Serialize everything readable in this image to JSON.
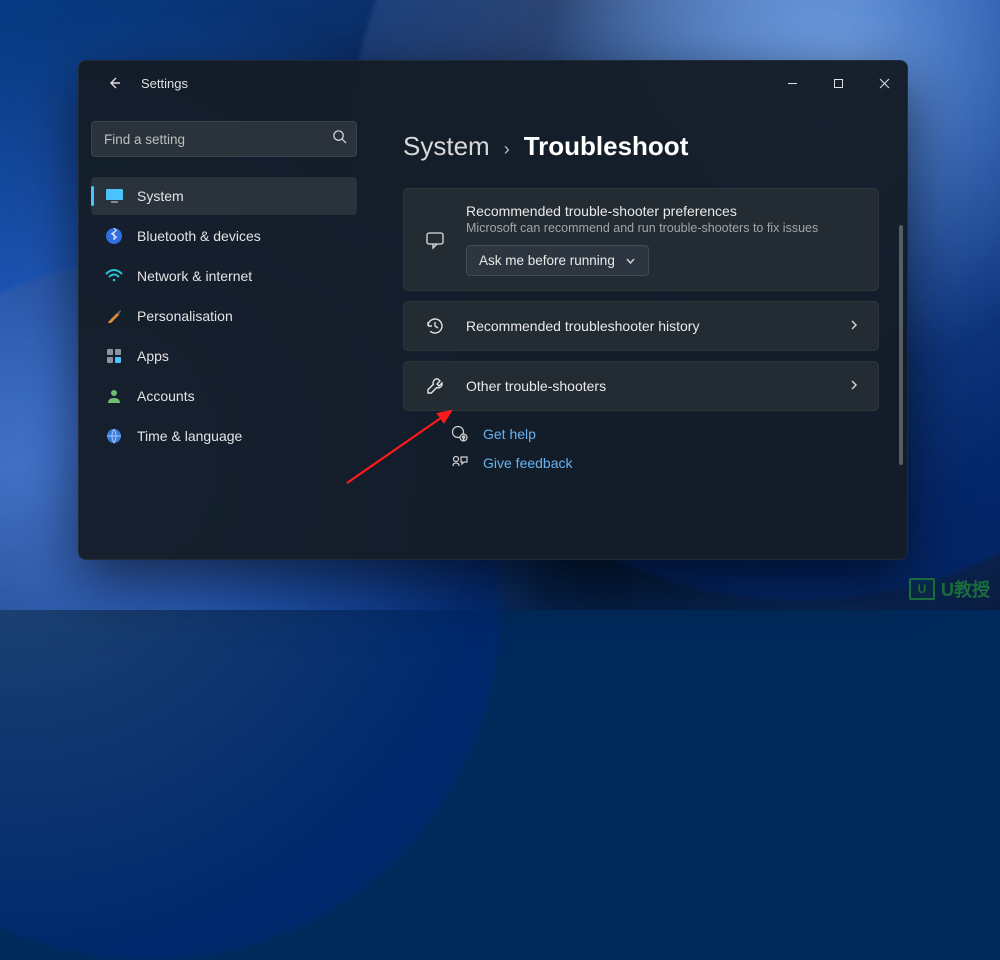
{
  "header": {
    "app_title": "Settings"
  },
  "sidebar": {
    "search_placeholder": "Find a setting",
    "items": [
      {
        "icon": "display-icon",
        "label": "System",
        "active": true
      },
      {
        "icon": "bluetooth-icon",
        "label": "Bluetooth & devices",
        "active": false
      },
      {
        "icon": "wifi-icon",
        "label": "Network & internet",
        "active": false
      },
      {
        "icon": "brush-icon",
        "label": "Personalisation",
        "active": false
      },
      {
        "icon": "apps-icon",
        "label": "Apps",
        "active": false
      },
      {
        "icon": "account-icon",
        "label": "Accounts",
        "active": false
      },
      {
        "icon": "time-lang-icon",
        "label": "Time & language",
        "active": false
      }
    ]
  },
  "main": {
    "breadcrumb_parent": "System",
    "breadcrumb_current": "Troubleshoot",
    "card_pref": {
      "title": "Recommended trouble-shooter preferences",
      "subtitle": "Microsoft can recommend and run trouble-shooters to fix issues",
      "dropdown_value": "Ask me before running"
    },
    "card_history": {
      "title": "Recommended troubleshooter history"
    },
    "card_other": {
      "title": "Other trouble-shooters"
    },
    "link_help": "Get help",
    "link_feedback": "Give feedback"
  },
  "watermark": {
    "badge": "U",
    "text": "U教授"
  }
}
